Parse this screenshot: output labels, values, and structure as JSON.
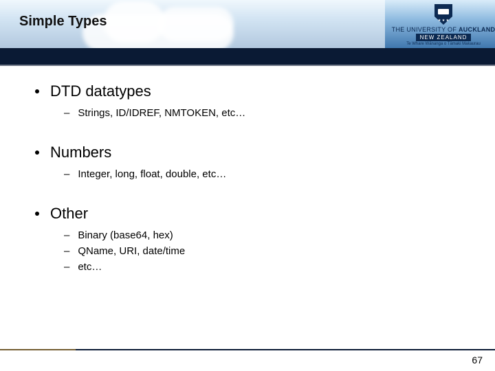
{
  "title": "Simple Types",
  "logo": {
    "line1": "THE UNIVERSITY OF",
    "line2": "AUCKLAND",
    "line3": "NEW ZEALAND",
    "maori": "Te Whare Wānanga o Tāmaki Makaurau"
  },
  "bullets": [
    {
      "label": "DTD datatypes",
      "sub": [
        "Strings, ID/IDREF, NMTOKEN, etc…"
      ]
    },
    {
      "label": "Numbers",
      "sub": [
        "Integer, long, float, double, etc…"
      ]
    },
    {
      "label": "Other",
      "sub": [
        "Binary (base64, hex)",
        "QName, URI, date/time",
        "etc…"
      ]
    }
  ],
  "page_number": "67"
}
